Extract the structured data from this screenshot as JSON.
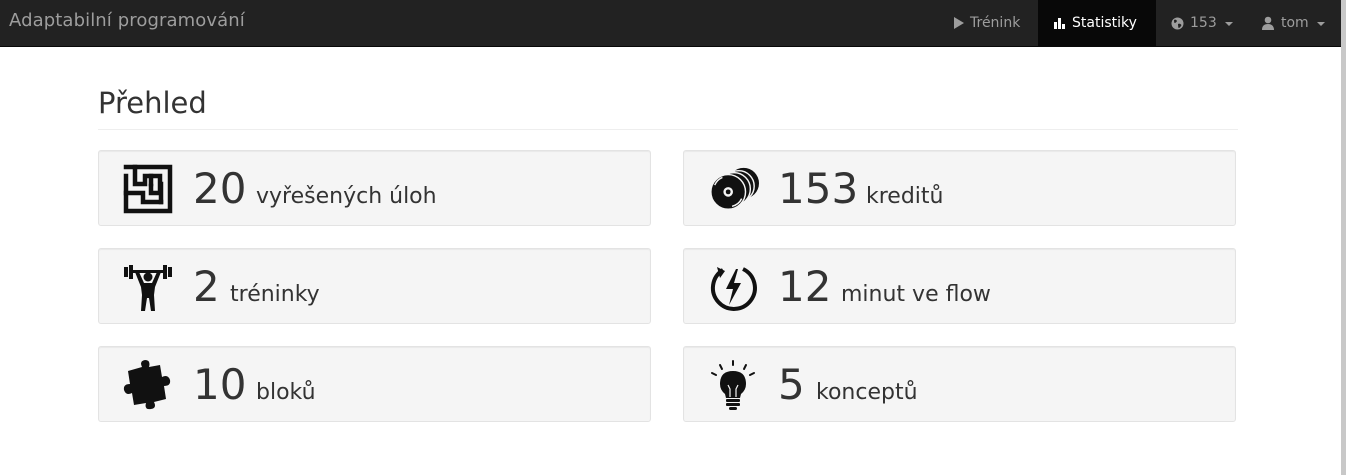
{
  "app": {
    "title": "Adaptabilní programování"
  },
  "nav": {
    "training": {
      "label": "Trénink",
      "icon": "play-icon"
    },
    "statistics": {
      "label": "Statistiky",
      "icon": "bar-chart-icon"
    },
    "credits": {
      "label": "153",
      "icon": "globe-icon"
    },
    "user": {
      "label": "tom",
      "icon": "user-icon"
    }
  },
  "page": {
    "heading": "Přehled"
  },
  "stats": [
    {
      "value": "20",
      "label": "vyřešených úloh",
      "icon": "maze-icon"
    },
    {
      "value": "153",
      "label": "kreditů",
      "icon": "coins-icon"
    },
    {
      "value": "2",
      "label": "tréninky",
      "icon": "weightlifter-icon"
    },
    {
      "value": "12",
      "label": "minut ve flow",
      "icon": "flow-lightning-icon"
    },
    {
      "value": "10",
      "label": "bloků",
      "icon": "puzzle-piece-icon"
    },
    {
      "value": "5",
      "label": "konceptů",
      "icon": "lightbulb-icon"
    }
  ],
  "colors": {
    "navbar": "#222222",
    "navbar_active": "#080808",
    "nav_text": "#9d9d9d",
    "card_bg": "#f5f5f5"
  }
}
